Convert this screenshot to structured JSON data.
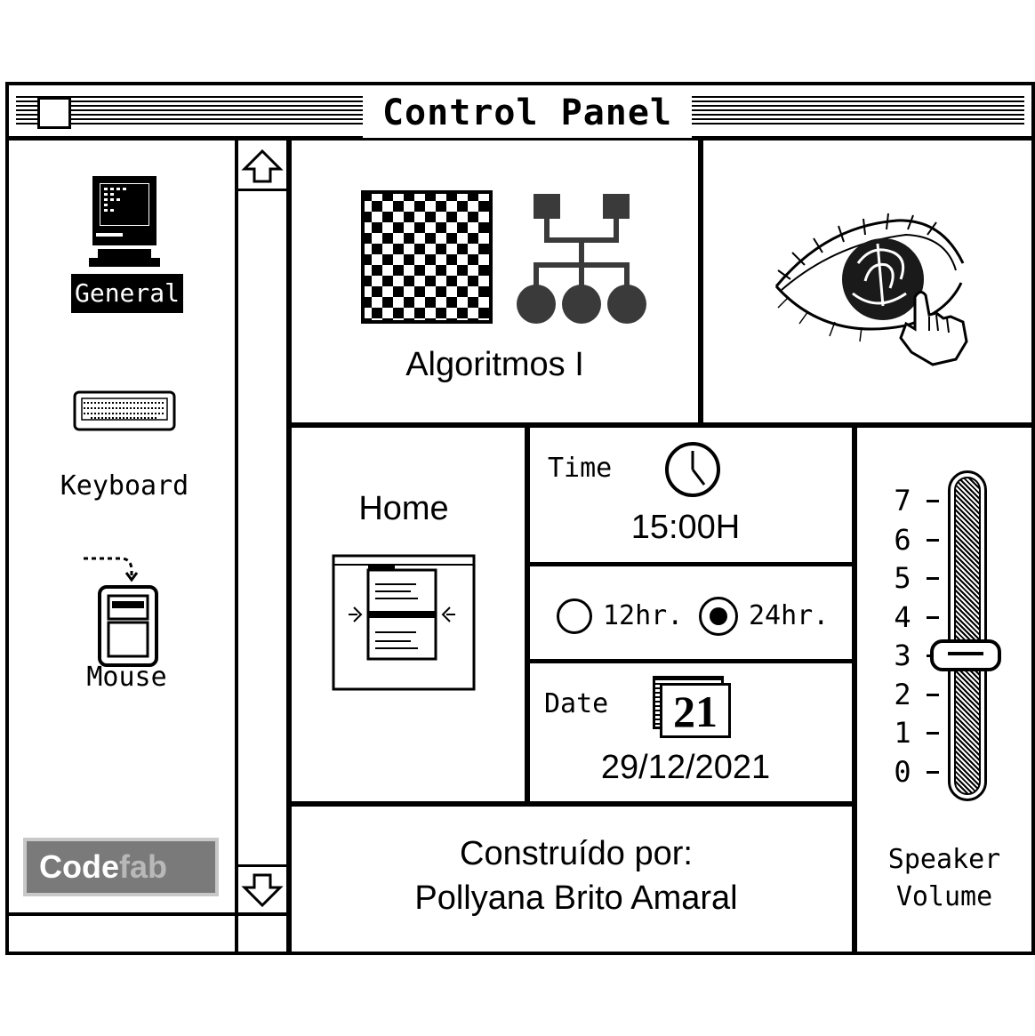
{
  "window": {
    "title": "Control Panel"
  },
  "sidebar": {
    "items": [
      {
        "label": "General",
        "icon": "computer-icon",
        "selected": true
      },
      {
        "label": "Keyboard",
        "icon": "keyboard-icon",
        "selected": false
      },
      {
        "label": "Mouse",
        "icon": "mouse-icon",
        "selected": false
      }
    ],
    "brand": {
      "part1": "Code",
      "part2": "fab"
    }
  },
  "panels": {
    "algoritmos": {
      "label": "Algoritmos I",
      "icons": [
        "checkerboard-icon",
        "network-tree-icon"
      ]
    },
    "eye": {
      "icon": "eye-with-pointer-icon"
    },
    "home": {
      "label": "Home",
      "icon": "window-pane-icon"
    },
    "time": {
      "label": "Time",
      "value": "15:00H",
      "icon": "clock-icon"
    },
    "clock_format": {
      "option_12": "12hr.",
      "option_24": "24hr.",
      "selected": "24hr."
    },
    "date": {
      "label": "Date",
      "value": "29/12/2021",
      "icon": "calendar-icon",
      "calendar_day": "21"
    },
    "credits": {
      "line1": "Construído por:",
      "line2": "Pollyana Brito Amaral"
    },
    "speaker": {
      "label_line1": "Speaker",
      "label_line2": "Volume",
      "ticks": [
        "7",
        "6",
        "5",
        "4",
        "3",
        "2",
        "1",
        "0"
      ],
      "level": 3
    }
  }
}
